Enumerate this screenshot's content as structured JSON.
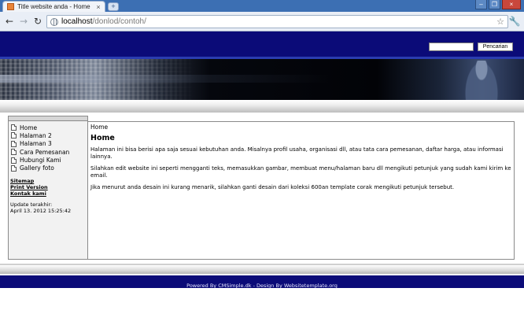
{
  "browser": {
    "tab_title": "Title website anda - Home",
    "tab_close": "×",
    "new_tab": "+",
    "window_buttons": [
      "–",
      "❐",
      "×"
    ],
    "url_host": "localhost",
    "url_path": "/donlod/contoh/",
    "nav": {
      "back": "←",
      "forward": "→",
      "reload": "↻",
      "star": "☆",
      "wrench": "🔧"
    }
  },
  "header": {
    "search_placeholder": "",
    "search_button": "Pencarian"
  },
  "sidebar": {
    "menu": [
      {
        "label": "Home"
      },
      {
        "label": "Halaman 2"
      },
      {
        "label": "Halaman 3"
      },
      {
        "label": "Cara Pemesanan"
      },
      {
        "label": "Hubungi Kami"
      },
      {
        "label": "Gallery foto"
      }
    ],
    "links": [
      {
        "label": "Sitemap"
      },
      {
        "label": "Print Version"
      },
      {
        "label": "Kontak kami"
      }
    ],
    "update_label": "Update terakhir:",
    "update_time": "April 13. 2012 15:25:42"
  },
  "content": {
    "breadcrumb": "Home",
    "title": "Home",
    "paragraphs": [
      "Halaman ini bisa berisi apa saja sesuai kebutuhan anda. Misalnya profil usaha, organisasi dll, atau tata cara pemesanan, daftar harga, atau informasi lainnya.",
      "Silahkan edit website ini seperti mengganti teks, memasukkan gambar, membuat menu/halaman baru dll mengikuti petunjuk yang sudah kami kirim ke email.",
      "Jika menurut anda desain ini kurang menarik, silahkan ganti desain dari koleksi 600an template corak mengikuti petunjuk tersebut."
    ]
  },
  "footer": {
    "text": "Powered By CMSimple.dk - Design By Websitetemplate.org"
  },
  "colors": {
    "header_navy": "#0b0b78",
    "sidebar_bg": "#f2f2f2",
    "border_gray": "#8a8a8a"
  }
}
